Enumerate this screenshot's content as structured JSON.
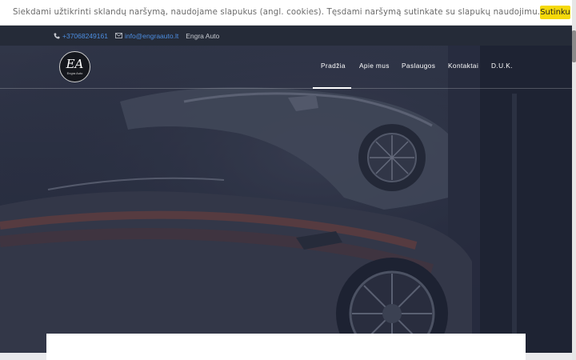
{
  "cookie_bar": {
    "text": "Siekdami užtikrinti sklandų naršymą, naudojame slapukus (angl. cookies). Tęsdami naršymą sutinkate su slapukų naudojimu.",
    "accept_label": "Sutinku",
    "accept_color": "#f5d90a"
  },
  "topbar": {
    "phone": "+37068249161",
    "email": "info@engraauto.lt",
    "company": "Engra Auto",
    "phone_icon": "phone-icon",
    "email_icon": "envelope-icon"
  },
  "logo": {
    "mark": "EA",
    "subtitle": "Engra Auto"
  },
  "nav": {
    "items": [
      {
        "label": "Pradžia",
        "active": true
      },
      {
        "label": "Apie mus",
        "active": false
      },
      {
        "label": "Paslaugos",
        "active": false
      },
      {
        "label": "Kontaktai",
        "active": false
      },
      {
        "label": "D.U.K.",
        "active": false
      }
    ]
  },
  "colors": {
    "link": "#4c8de0",
    "topbar_bg": "#252b38",
    "hero_overlay": "#232838"
  }
}
